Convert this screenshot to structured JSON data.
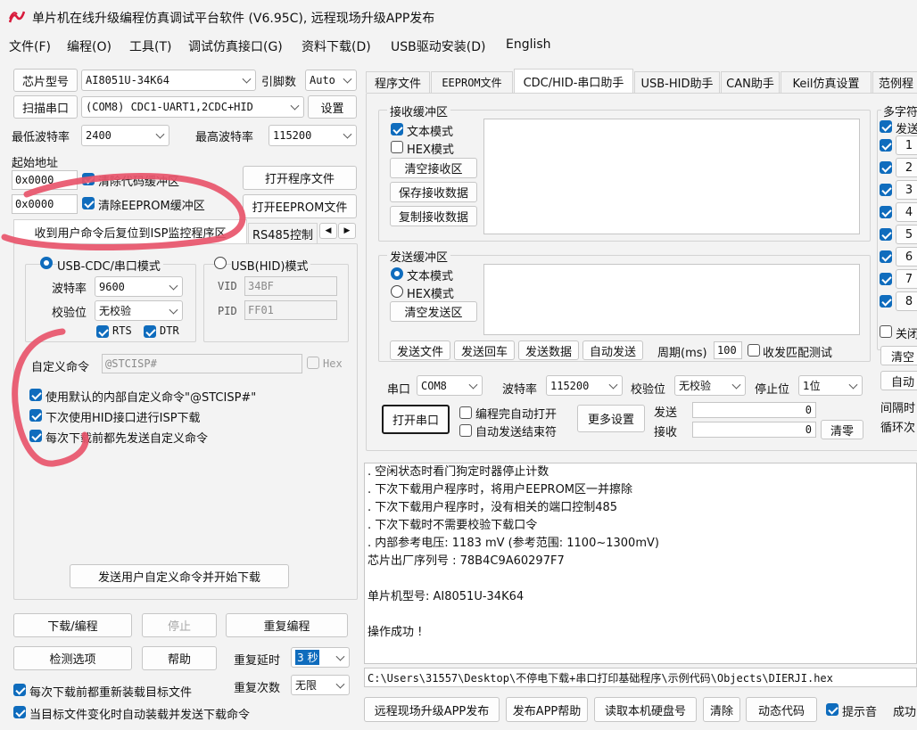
{
  "window": {
    "title": "单片机在线升级编程仿真调试平台软件 (V6.95C), 远程现场升级APP发布"
  },
  "menu": [
    "文件(F)",
    "编程(O)",
    "工具(T)",
    "调试仿真接口(G)",
    "资料下载(D)",
    "USB驱动安装(D)",
    "English"
  ],
  "left": {
    "chip_model_button": "芯片型号",
    "chip_model_value": "AI8051U-34K64",
    "pin_count_label": "引脚数",
    "pin_count_value": "Auto",
    "scan_port_button": "扫描串口",
    "port_value": "(COM8) CDC1-UART1,2CDC+HID",
    "settings_button": "设置",
    "min_baud_label": "最低波特率",
    "min_baud_value": "2400",
    "max_baud_label": "最高波特率",
    "max_baud_value": "115200",
    "start_addr_label": "起始地址",
    "code_addr_value": "0x0000",
    "clear_code_label": "清除代码缓冲区",
    "open_program_button": "打开程序文件",
    "eeprom_addr_value": "0x0000",
    "clear_eeprom_label": "清除EEPROM缓冲区",
    "open_eeprom_button": "打开EEPROM文件",
    "subtabs": [
      "收到用户命令后复位到ISP监控程序区",
      "RS485控制"
    ],
    "usb_cdc_mode": "USB-CDC/串口模式",
    "usb_hid_mode": "USB(HID)模式",
    "baud_label": "波特率",
    "baud_value": "9600",
    "parity_label": "校验位",
    "parity_value": "无校验",
    "rts_label": "RTS",
    "dtr_label": "DTR",
    "vid_label": "VID",
    "vid_value": "34BF",
    "pid_label": "PID",
    "pid_value": "FF01",
    "custom_cmd_label": "自定义命令",
    "custom_cmd_value": "@STCISP#",
    "hex_label": "Hex",
    "option1": "使用默认的内部自定义命令\"@STCISP#\"",
    "option2": "下次使用HID接口进行ISP下载",
    "option3": "每次下载前都先发送自定义命令",
    "send_custom_button": "发送用户自定义命令并开始下载",
    "download_button": "下载/编程",
    "stop_button": "停止",
    "reprogram_button": "重复编程",
    "detect_button": "检测选项",
    "help_button": "帮助",
    "repeat_delay_label": "重复延时",
    "repeat_delay_value": "3 秒",
    "repeat_count_label": "重复次数",
    "repeat_count_value": "无限",
    "reload_label": "每次下载前都重新装载目标文件",
    "autoload_label": "当目标文件变化时自动装载并发送下载命令"
  },
  "tabs": [
    "程序文件",
    "EEPROM文件",
    "CDC/HID-串口助手",
    "USB-HID助手",
    "CAN助手",
    "Keil仿真设置",
    "范例程"
  ],
  "serial": {
    "rx_group": "接收缓冲区",
    "rx_text_mode": "文本模式",
    "rx_hex_mode": "HEX模式",
    "clear_rx": "清空接收区",
    "save_rx": "保存接收数据",
    "copy_rx": "复制接收数据",
    "tx_group": "发送缓冲区",
    "tx_text_mode": "文本模式",
    "tx_hex_mode": "HEX模式",
    "clear_tx": "清空发送区",
    "send_file": "发送文件",
    "send_echo": "发送回车",
    "send_data": "发送数据",
    "auto_send": "自动发送",
    "period_label": "周期(ms)",
    "period_value": "100",
    "match_test": "收发匹配测试",
    "port_label": "串口",
    "port_value": "COM8",
    "baud_label": "波特率",
    "baud_value": "115200",
    "parity_label": "校验位",
    "parity_value": "无校验",
    "stop_label": "停止位",
    "stop_value": "1位",
    "open_port": "打开串口",
    "auto_open": "编程完自动打开",
    "auto_end": "自动发送结束符",
    "more_settings": "更多设置",
    "send_label": "发送",
    "send_count": "0",
    "recv_label": "接收",
    "recv_count": "0",
    "clear_count": "清零",
    "multi_group": "多字符",
    "multi_send": "发送",
    "multi_items": [
      "1",
      "2",
      "3",
      "4",
      "5",
      "6",
      "7",
      "8"
    ],
    "close_label": "关闭",
    "clear_all": "清空",
    "auto_btn": "自动",
    "interval_label": "间隔时",
    "loop_label": "循环次"
  },
  "log": [
    "  . 空闲状态时看门狗定时器停止计数",
    "  . 下次下载用户程序时，将用户EEPROM区一并擦除",
    "  . 下次下载用户程序时，没有相关的端口控制485",
    "  . 下次下载时不需要校验下载口令",
    "  . 内部参考电压: 1183 mV (参考范围: 1100~1300mV)",
    "芯片出厂序列号 : 78B4C9A60297F7",
    "",
    "  单片机型号: AI8051U-34K64",
    "",
    "操作成功 !"
  ],
  "path": "C:\\Users\\31557\\Desktop\\不停电下载+串口打印基础程序\\示例代码\\Objects\\DIERJI.hex",
  "bottom": [
    "远程现场升级APP发布",
    "发布APP帮助",
    "读取本机硬盘号",
    "清除",
    "动态代码",
    "提示音",
    "成功"
  ]
}
